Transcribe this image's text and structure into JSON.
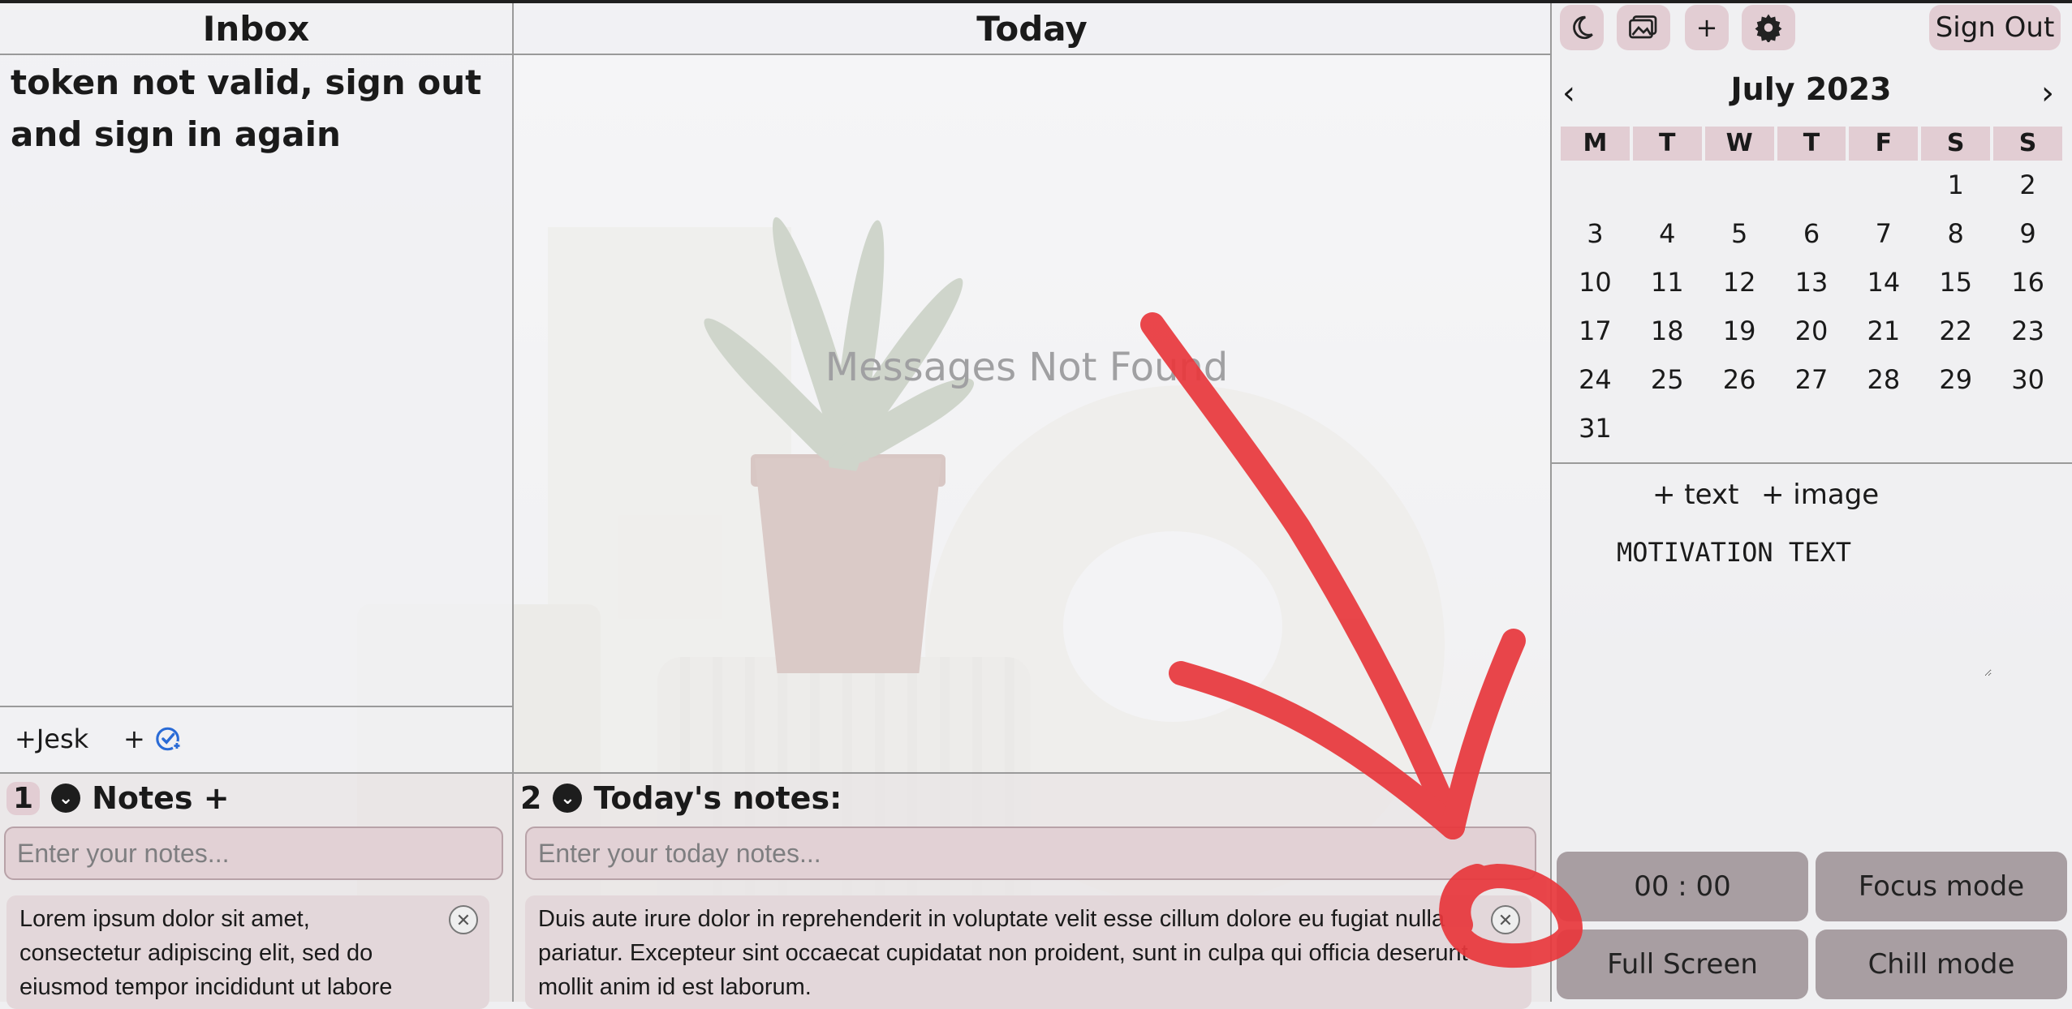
{
  "columns": {
    "inbox": "Inbox",
    "today": "Today"
  },
  "inbox": {
    "message": "token not valid, sign out and sign in again",
    "desk_button": "+Jesk",
    "add_task_prefix": "+",
    "add_task_icon": "calendar-check-icon"
  },
  "today": {
    "empty_message": "Messages Not Found"
  },
  "notes": {
    "left": {
      "count": "1",
      "title": "Notes +",
      "placeholder": "Enter your notes...",
      "items": [
        {
          "text": "Lorem ipsum dolor sit amet, consectetur adipiscing elit, sed do eiusmod tempor incididunt ut labore"
        }
      ]
    },
    "center": {
      "count": "2",
      "title": "Today's notes:",
      "placeholder": "Enter your today notes...",
      "items": [
        {
          "text": "Duis aute irure dolor in reprehenderit in voluptate velit esse cillum dolore eu fugiat nulla pariatur. Excepteur sint occaecat cupidatat non proident, sunt in culpa qui officia deserunt mollit anim id est laborum."
        }
      ]
    }
  },
  "toolbar": {
    "theme_icon": "moon-icon",
    "image_icon": "image-icon",
    "add_label": "+",
    "settings_icon": "gear-icon",
    "sign_out": "Sign Out"
  },
  "calendar": {
    "month_label": "July 2023",
    "prev": "‹",
    "next": "›",
    "weekdays": [
      "M",
      "T",
      "W",
      "T",
      "F",
      "S",
      "S"
    ],
    "leading_blanks": 5,
    "days_in_month": 31
  },
  "widgets": {
    "add_text": "+ text",
    "add_image": "+ image",
    "motivation": "MOTIVATION TEXT"
  },
  "controls": {
    "timer": "00 : 00",
    "focus_mode": "Focus mode",
    "full_screen": "Full Screen",
    "chill_mode": "Chill mode"
  },
  "colors": {
    "accent": "#e2cdd3",
    "button": "#a89ea2",
    "annotation": "#e8373c"
  }
}
